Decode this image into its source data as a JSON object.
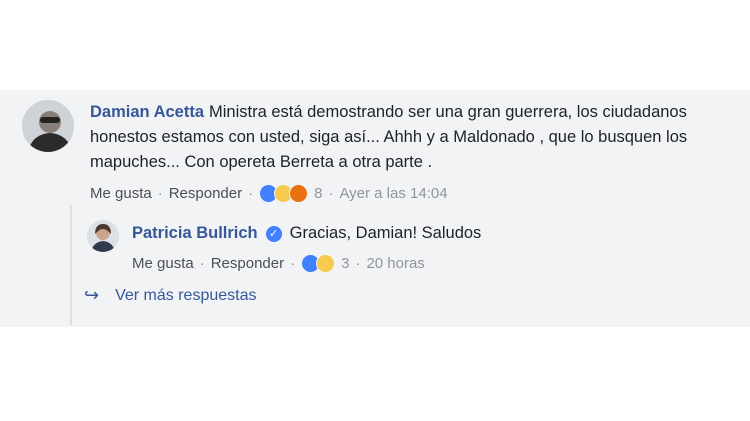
{
  "comment": {
    "author": "Damian Acetta",
    "text": "Ministra está demostrando ser una gran guerrera, los ciudadanos honestos estamos con usted, siga así... Ahhh y a Maldonado , que lo busquen los mapuches... Con opereta Berreta a otra parte .",
    "like_label": "Me gusta",
    "reply_label": "Responder",
    "reaction_icons": [
      "like-reaction-icon",
      "haha-reaction-icon",
      "angry-reaction-icon"
    ],
    "reaction_count": "8",
    "timestamp": "Ayer a las 14:04"
  },
  "reply": {
    "author": "Patricia Bullrich",
    "text": "Gracias, Damian! Saludos",
    "like_label": "Me gusta",
    "reply_label": "Responder",
    "reaction_icons": [
      "like-reaction-icon",
      "sad-reaction-icon"
    ],
    "reaction_count": "3",
    "timestamp": "20 horas"
  },
  "more_replies": "Ver más respuestas",
  "colors": {
    "link": "#365899",
    "meta": "#90949c",
    "background": "#f2f3f5"
  }
}
